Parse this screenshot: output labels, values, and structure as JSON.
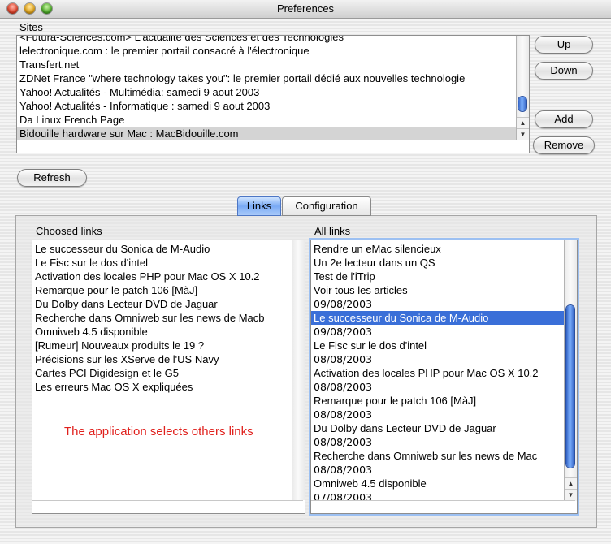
{
  "window": {
    "title": "Preferences"
  },
  "sites": {
    "label": "Sites",
    "items": [
      "<Futura-Sciences.com> L'actualité des Sciences et des Technologies",
      "lelectronique.com : le premier portail consacré à l'électronique",
      "Transfert.net",
      "ZDNet France \"where technology takes you\": le premier portail dédié aux nouvelles technologie",
      "Yahoo! Actualités - Multimédia: samedi 9 aout 2003",
      "Yahoo! Actualités - Informatique : samedi 9 aout 2003",
      "Da Linux French Page",
      "Bidouille hardware sur Mac : MacBidouille.com"
    ],
    "selected_index": 7
  },
  "buttons": {
    "up": "Up",
    "down": "Down",
    "add": "Add",
    "remove": "Remove",
    "refresh": "Refresh"
  },
  "tabs": [
    {
      "label": "Links",
      "active": true
    },
    {
      "label": "Configuration",
      "active": false
    }
  ],
  "choosed_links": {
    "label": "Choosed links",
    "items": [
      "Le successeur du Sonica de M-Audio",
      "Le Fisc sur le dos d'intel",
      "Activation des locales PHP pour Mac OS X 10.2",
      "Remarque pour le patch 106 [MàJ]",
      "Du Dolby dans Lecteur DVD de Jaguar",
      "Recherche dans Omniweb sur les news de Macb",
      "Omniweb 4.5 disponible",
      "[Rumeur] Nouveaux produits le 19 ?",
      "Précisions sur les XServe de l'US Navy",
      "Cartes PCI Digidesign et le G5",
      "Les erreurs Mac OS X expliquées"
    ],
    "annotation": "The application selects others links"
  },
  "all_links": {
    "label": "All links",
    "items": [
      "Rendre un eMac silencieux",
      "Un 2e lecteur dans un QS",
      "Test de l'iTrip",
      "Voir tous les articles",
      "09/08/2003",
      "Le successeur du Sonica de M-Audio",
      "09/08/2003",
      "Le Fisc sur le dos d'intel",
      "08/08/2003",
      "Activation des locales PHP pour Mac OS X 10.2",
      "08/08/2003",
      "Remarque pour le patch 106 [MàJ]",
      "08/08/2003",
      "Du Dolby dans Lecteur DVD de Jaguar",
      "08/08/2003",
      "Recherche dans Omniweb sur les news de Mac",
      "08/08/2003",
      "Omniweb 4.5 disponible",
      "07/08/2003"
    ],
    "selected_index": 5
  },
  "colors": {
    "selection_blue": "#3a6fd8",
    "selection_grey": "#d4d4d4",
    "annotation_red": "#e0201c"
  }
}
